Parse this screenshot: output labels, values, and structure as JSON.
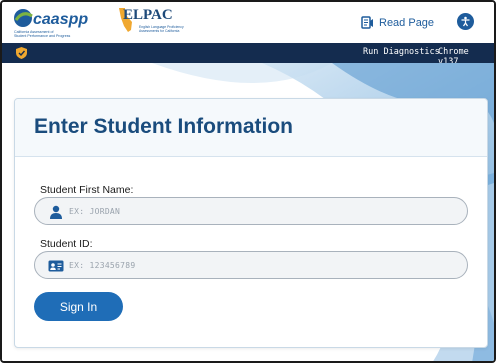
{
  "header": {
    "caaspp_name": "caaspp",
    "caaspp_tagline": "California Assessment of Student Performance and Progress",
    "elpac_name": "ELPAC",
    "elpac_tagline": "English Language Proficiency Assessments for California",
    "read_page_label": "Read Page"
  },
  "navbar": {
    "diagnostics_label": "Run Diagnostics",
    "browser_label": "Chrome v137"
  },
  "card": {
    "title": "Enter Student Information",
    "first_name_label": "Student First Name:",
    "first_name_placeholder": "EX: JORDAN",
    "first_name_value": "",
    "student_id_label": "Student ID:",
    "student_id_placeholder": "EX: 123456789",
    "student_id_value": "",
    "signin_label": "Sign In"
  },
  "colors": {
    "brand_blue": "#1e5c9c",
    "nav_bg": "#142c4f",
    "button_blue": "#1f6db7",
    "title_blue": "#1a4c7d"
  }
}
